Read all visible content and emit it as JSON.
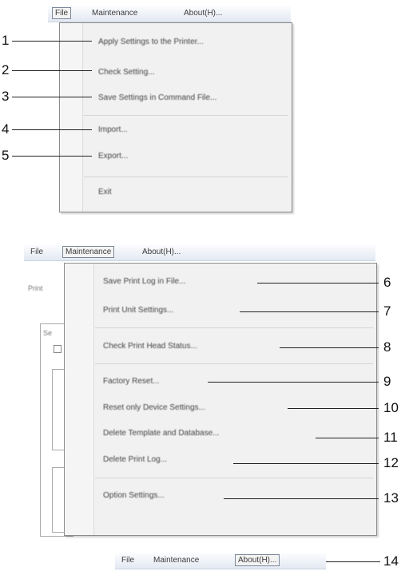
{
  "panel1": {
    "menubar": {
      "file": "File",
      "maintenance": "Maintenance",
      "about": "About(H)..."
    },
    "items": [
      {
        "label": "Apply Settings to the Printer...",
        "callout": "1"
      },
      {
        "label": "Check Setting...",
        "callout": "2"
      },
      {
        "label": "Save Settings in Command File...",
        "callout": "3"
      },
      {
        "label": "Import...",
        "callout": "4"
      },
      {
        "label": "Export...",
        "callout": "5"
      },
      {
        "label": "Exit",
        "callout": ""
      }
    ]
  },
  "panel2": {
    "menubar": {
      "file": "File",
      "maintenance": "Maintenance",
      "about": "About(H)..."
    },
    "bg_fragments": [
      "Print",
      "Se"
    ],
    "items": [
      {
        "label": "Save Print Log in File...",
        "callout": "6"
      },
      {
        "label": "Print Unit Settings...",
        "callout": "7"
      },
      {
        "label": "Check Print Head Status...",
        "callout": "8"
      },
      {
        "label": "Factory Reset...",
        "callout": "9"
      },
      {
        "label": "Reset only Device Settings...",
        "callout": "10"
      },
      {
        "label": "Delete Template and Database...",
        "callout": "11"
      },
      {
        "label": "Delete Print Log...",
        "callout": "12"
      },
      {
        "label": "Option Settings...",
        "callout": "13"
      }
    ]
  },
  "panel3": {
    "menubar": {
      "file": "File",
      "maintenance": "Maintenance",
      "about": "About(H)..."
    },
    "callout": "14"
  }
}
